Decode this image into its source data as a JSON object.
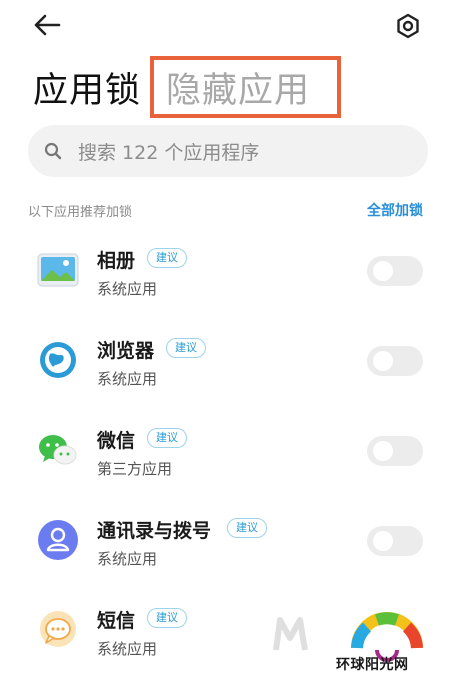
{
  "header": {
    "back_icon": "arrow-left-icon",
    "settings_icon": "gear-icon"
  },
  "title": {
    "main": "应用锁",
    "tab_hidden": "隐藏应用",
    "highlight_color": "#e8623a"
  },
  "search": {
    "icon": "search-icon",
    "placeholder": "搜索 122 个应用程序"
  },
  "section": {
    "title": "以下应用推荐加锁",
    "action": "全部加锁",
    "action_color": "#2a8fd6"
  },
  "apps": [
    {
      "name": "相册",
      "badge": "建议",
      "category": "系统应用",
      "icon": "gallery-icon",
      "locked": false
    },
    {
      "name": "浏览器",
      "badge": "建议",
      "category": "系统应用",
      "icon": "browser-icon",
      "locked": false
    },
    {
      "name": "微信",
      "badge": "建议",
      "category": "第三方应用",
      "icon": "wechat-icon",
      "locked": false
    },
    {
      "name": "通讯录与拨号",
      "badge": "建议",
      "category": "系统应用",
      "icon": "contacts-icon",
      "locked": false
    },
    {
      "name": "短信",
      "badge": "建议",
      "category": "系统应用",
      "icon": "messages-icon",
      "locked": false
    }
  ],
  "watermark": {
    "text": "环球阳光网"
  }
}
